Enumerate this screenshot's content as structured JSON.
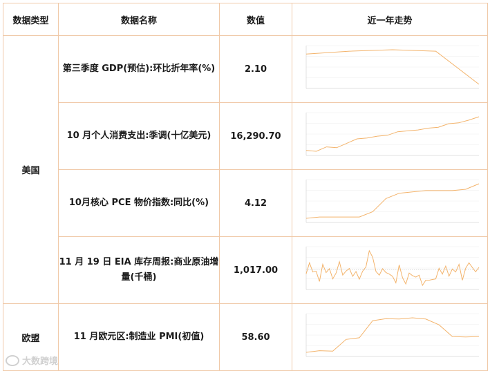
{
  "header": {
    "type": "数据类型",
    "name": "数据名称",
    "value": "数值",
    "trend": "近一年走势"
  },
  "groups": [
    {
      "label": "美国"
    },
    {
      "label": "欧盟"
    }
  ],
  "rows": [
    {
      "name": "第三季度 GDP(预估):环比折年率(%)",
      "value": "2.10"
    },
    {
      "name": "10 月个人消费支出:季调(十亿美元)",
      "value": "16,290.70"
    },
    {
      "name": "10月核心 PCE 物价指数:同比(%)",
      "value": "4.12"
    },
    {
      "name": "11 月 19 日 EIA 库存周报:商业原油增量(千桶)",
      "value": "1,017.00"
    },
    {
      "name": "11 月欧元区:制造业 PMI(初值)",
      "value": "58.60"
    }
  ],
  "watermark": {
    "text": "大数跨境"
  },
  "colors": {
    "line": "#f3b36b",
    "border": "#f0c9a8"
  },
  "chart_data": [
    {
      "type": "line",
      "series": [
        {
          "values": [
            6.3,
            6.7,
            6.9,
            6.7,
            2.1
          ]
        }
      ]
    },
    {
      "type": "line",
      "series": [
        {
          "values": [
            14400,
            14350,
            14600,
            14550,
            14800,
            15050,
            15100,
            15200,
            15250,
            15450,
            15500,
            15550,
            15650,
            15700,
            15900,
            15950,
            16100,
            16290.7
          ]
        }
      ]
    },
    {
      "type": "line",
      "series": [
        {
          "values": [
            1.5,
            1.6,
            1.6,
            1.6,
            1.6,
            2.0,
            3.0,
            3.4,
            3.5,
            3.6,
            3.6,
            3.6,
            3.7,
            4.12
          ]
        }
      ]
    },
    {
      "type": "line",
      "series": [
        {
          "values": [
            -1500,
            2800,
            -800,
            -500,
            -4500,
            2200,
            -1000,
            500,
            -3500,
            -1200,
            3200,
            -2000,
            -400,
            600,
            -2500,
            -600,
            -3600,
            -500,
            1200,
            7500,
            5000,
            -600,
            -2000,
            500,
            -1000,
            -1600,
            -2500,
            -5000,
            2000,
            -3000,
            -5500,
            -1200,
            -2200,
            -2800,
            -2000,
            -6000,
            -4000,
            -4000,
            -3700,
            -3500,
            700,
            -1600,
            1500,
            -2400,
            400,
            -800,
            2200,
            -4000,
            700,
            2800,
            1000,
            -700,
            1017
          ]
        }
      ]
    },
    {
      "type": "line",
      "series": [
        {
          "values": [
            54.8,
            55.2,
            55.1,
            57.9,
            58.3,
            62.4,
            62.9,
            62.8,
            63.1,
            62.8,
            61.4,
            58.6,
            58.5,
            58.6
          ]
        }
      ]
    }
  ]
}
